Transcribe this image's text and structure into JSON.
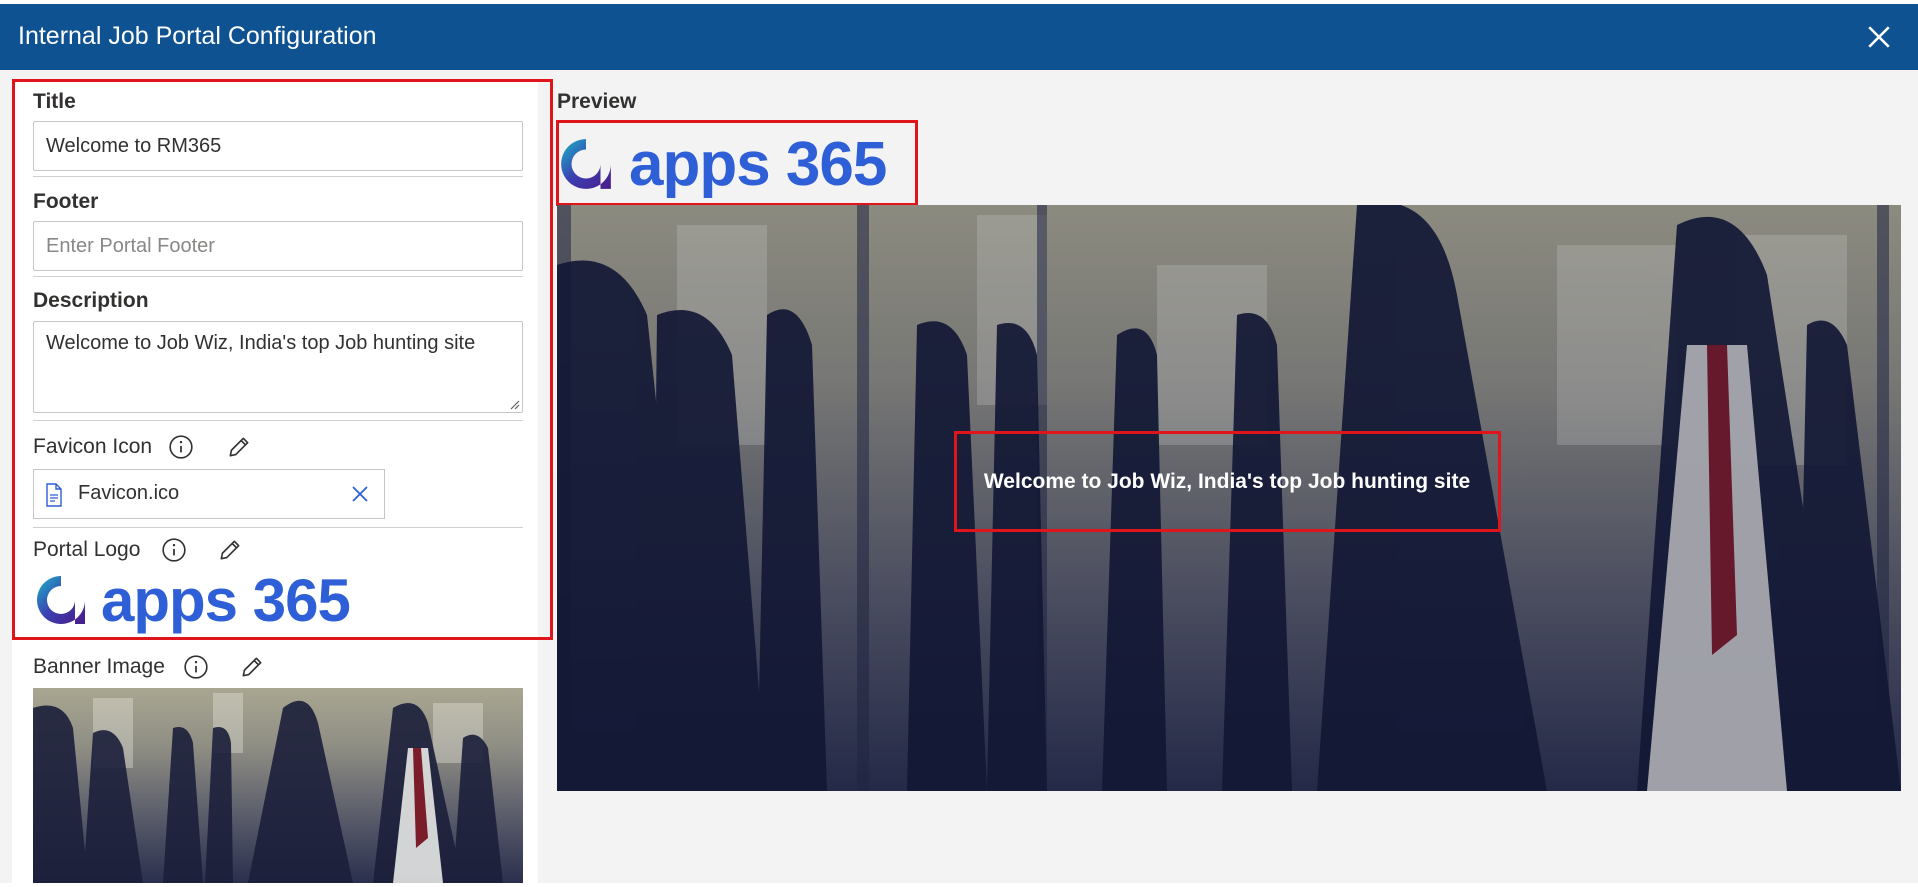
{
  "dialog": {
    "title": "Internal Job Portal Configuration"
  },
  "form": {
    "title_label": "Title",
    "title_value": "Welcome to RM365",
    "footer_label": "Footer",
    "footer_placeholder": "Enter Portal Footer",
    "description_label": "Description",
    "description_value": "Welcome to Job Wiz, India's top Job hunting site",
    "favicon_label": "Favicon Icon",
    "favicon_file": "Favicon.ico",
    "portal_logo_label": "Portal Logo",
    "logo_text": "apps 365",
    "banner_label": "Banner Image"
  },
  "preview": {
    "label": "Preview",
    "logo_text": "apps 365",
    "banner_text": "Welcome to Job Wiz, India's top Job hunting site"
  },
  "colors": {
    "titlebar": "#0f5291",
    "highlight": "#e0151b",
    "logo_blue": "#2f5fd6"
  }
}
